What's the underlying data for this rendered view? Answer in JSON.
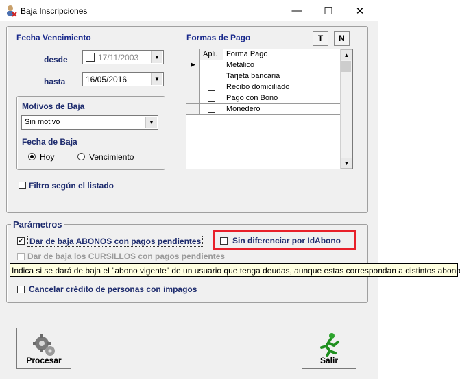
{
  "window": {
    "title": "Baja Inscripciones",
    "minimize": "—",
    "maximize": "☐",
    "close": "✕"
  },
  "fecha_vencimiento": {
    "label": "Fecha Vencimiento",
    "desde_label": "desde",
    "desde_value": "17/11/2003",
    "hasta_label": "hasta",
    "hasta_value": "16/05/2016"
  },
  "motivos": {
    "label": "Motivos de Baja",
    "selected": "Sin motivo",
    "fecha_baja_label": "Fecha de Baja",
    "options": [
      {
        "label": "Hoy",
        "checked": true
      },
      {
        "label": "Vencimiento",
        "checked": false
      }
    ]
  },
  "filtro": {
    "label": "Filtro según el listado",
    "checked": false
  },
  "formas_pago": {
    "label": "Formas de Pago",
    "btn_t": "T",
    "btn_n": "N",
    "col_apli": "Apli.",
    "col_forma": "Forma Pago",
    "rows": [
      {
        "name": "Metálico",
        "current": true
      },
      {
        "name": "Tarjeta bancaria",
        "current": false
      },
      {
        "name": "Recibo domiciliado",
        "current": false
      },
      {
        "name": "Pago con Bono",
        "current": false
      },
      {
        "name": "Monedero",
        "current": false
      }
    ]
  },
  "parametros": {
    "label": "Parámetros",
    "abonos": "Dar de baja ABONOS con pagos pendientes",
    "sin_diferenciar": "Sin diferenciar por IdAbono",
    "cursillos": "Dar de baja los CURSILLOS con pagos pendientes",
    "cancelar": "Cancelar crédito de personas con impagos"
  },
  "tooltip": "Indica si se dará de baja el \"abono vigente\" de un usuario que tenga deudas, aunque estas correspondan a distintos abonos.",
  "buttons": {
    "procesar": "Procesar",
    "salir": "Salir"
  },
  "colors": {
    "highlight_box": "#e8202a",
    "label_blue": "#1a2a8c"
  }
}
